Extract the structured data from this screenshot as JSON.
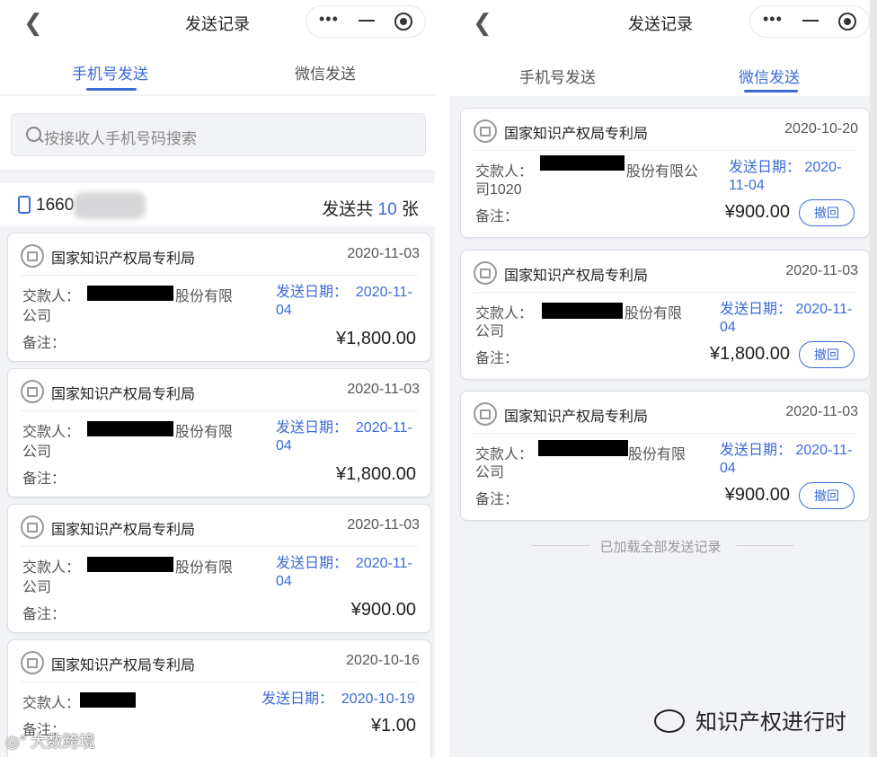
{
  "left": {
    "title": "发送记录",
    "tabs": [
      {
        "label": "手机号发送"
      },
      {
        "label": "微信发送"
      }
    ],
    "search_placeholder": "按接收人手机号码搜索",
    "phone_prefix": "1660",
    "count_prefix": "发送共",
    "count_num": "10",
    "count_suffix": "张",
    "cards": [
      {
        "org": "国家知识产权局专利局",
        "date": "2020-11-03",
        "payer_label": "交款人：",
        "payer_rest": "股份有限",
        "payer_line2": "公司",
        "send_label": "发送日期：",
        "send_date_a": "2020-11-",
        "send_date_b": "04",
        "remark": "备注：",
        "amount": "¥1,800.00"
      },
      {
        "org": "国家知识产权局专利局",
        "date": "2020-11-03",
        "payer_label": "交款人：",
        "payer_rest": "股份有限",
        "payer_line2": "公司",
        "send_label": "发送日期：",
        "send_date_a": "2020-11-",
        "send_date_b": "04",
        "remark": "备注：",
        "amount": "¥1,800.00"
      },
      {
        "org": "国家知识产权局专利局",
        "date": "2020-11-03",
        "payer_label": "交款人：",
        "payer_rest": "股份有限",
        "payer_line2": "公司",
        "send_label": "发送日期：",
        "send_date_a": "2020-11-",
        "send_date_b": "04",
        "remark": "备注：",
        "amount": "¥900.00"
      },
      {
        "org": "国家知识产权局专利局",
        "date": "2020-10-16",
        "payer_label": "交款人：",
        "send_label": "发送日期：",
        "send_date_a": "2020-10-19",
        "remark": "备注：",
        "amount": "¥1.00"
      }
    ]
  },
  "right": {
    "title": "发送记录",
    "tabs": [
      {
        "label": "手机号发送"
      },
      {
        "label": "微信发送"
      }
    ],
    "cards": [
      {
        "org": "国家知识产权局专利局",
        "date": "2020-10-20",
        "payer_label": "交款人：",
        "payer_rest": "股份有限公",
        "payer_line2": "司1020",
        "send_label": "发送日期：",
        "send_date_a": "2020-",
        "send_date_b": "11-04",
        "remark": "备注：",
        "amount": "¥900.00",
        "revoke": "撤回"
      },
      {
        "org": "国家知识产权局专利局",
        "date": "2020-11-03",
        "payer_label": "交款人：",
        "payer_rest": "股份有限",
        "payer_line2": "公司",
        "send_label": "发送日期：",
        "send_date_a": "2020-11-",
        "send_date_b": "04",
        "remark": "备注：",
        "amount": "¥1,800.00",
        "revoke": "撤回"
      },
      {
        "org": "国家知识产权局专利局",
        "date": "2020-11-03",
        "payer_label": "交款人：",
        "payer_rest": "股份有限",
        "payer_line2": "公司",
        "send_label": "发送日期：",
        "send_date_a": "2020-11-",
        "send_date_b": "04",
        "remark": "备注：",
        "amount": "¥900.00",
        "revoke": "撤回"
      }
    ],
    "loaded_text": "已加载全部发送记录"
  },
  "watermark_left": "大数跨境",
  "watermark_right": "知识产权进行时",
  "colors": {
    "accent": "#3c6bd8",
    "background": "#f2f3f7"
  }
}
